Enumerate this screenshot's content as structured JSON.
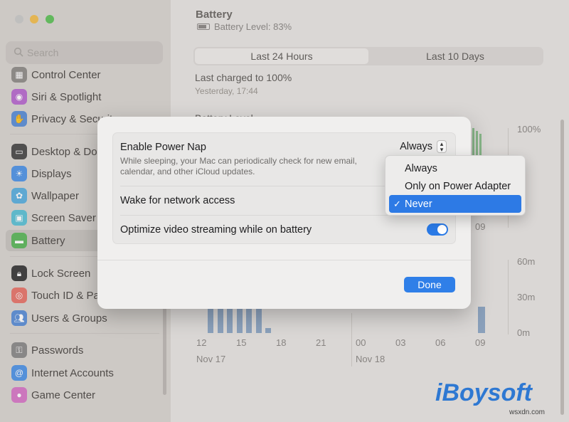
{
  "sidebar": {
    "search_placeholder": "Search",
    "items": [
      {
        "label": "Control Center",
        "icon": "control-center-icon",
        "color": "#8f8c89"
      },
      {
        "label": "Siri & Spotlight",
        "icon": "siri-icon",
        "color": "#b86ad0"
      },
      {
        "label": "Privacy & Security",
        "icon": "hand-icon",
        "color": "#5a8fd8"
      },
      {
        "label": "Desktop & Dock",
        "icon": "desktop-icon",
        "color": "#4a4a4a"
      },
      {
        "label": "Displays",
        "icon": "sun-icon",
        "color": "#4f94e8"
      },
      {
        "label": "Wallpaper",
        "icon": "flower-icon",
        "color": "#5bb0e0"
      },
      {
        "label": "Screen Saver",
        "icon": "screen-saver-icon",
        "color": "#5cc2d6"
      },
      {
        "label": "Battery",
        "icon": "battery-icon",
        "color": "#5cb85c"
      },
      {
        "label": "Lock Screen",
        "icon": "lock-icon",
        "color": "#3a3a3a"
      },
      {
        "label": "Touch ID & Password",
        "icon": "fingerprint-icon",
        "color": "#e8756a"
      },
      {
        "label": "Users & Groups",
        "icon": "users-icon",
        "color": "#5a8fd8"
      },
      {
        "label": "Passwords",
        "icon": "key-icon",
        "color": "#8a8a8a"
      },
      {
        "label": "Internet Accounts",
        "icon": "at-icon",
        "color": "#4f94e8"
      },
      {
        "label": "Game Center",
        "icon": "game-center-icon",
        "color": "#d878c8"
      }
    ]
  },
  "main": {
    "title": "Battery",
    "battery_level": "Battery Level: 83%",
    "tabs": [
      "Last 24 Hours",
      "Last 10 Days"
    ],
    "last_charged": "Last charged to 100%",
    "last_charged_time": "Yesterday, 17:44",
    "chart_label_partial": "Battery Level"
  },
  "chart_data": {
    "type": "bar",
    "title": "Battery Level",
    "yticks_level": [
      "100%"
    ],
    "yticks_usage": [
      "60m",
      "30m",
      "0m"
    ],
    "xticks": [
      "12",
      "15",
      "18",
      "21",
      "00",
      "03",
      "06",
      "09"
    ],
    "xtick_09_upper": "09",
    "date_labels": [
      "Nov 17",
      "Nov 18"
    ],
    "usage_values_min": [
      22,
      22,
      22,
      22,
      22,
      22,
      4,
      0,
      0,
      0,
      0,
      0,
      0,
      22
    ]
  },
  "dialog": {
    "rows": [
      {
        "title": "Enable Power Nap",
        "description": "While sleeping, your Mac can periodically check for new email, calendar, and other iCloud updates.",
        "value": "Always"
      },
      {
        "title": "Wake for network access"
      },
      {
        "title": "Optimize video streaming while on battery",
        "toggle": true
      }
    ],
    "done_label": "Done"
  },
  "menu": {
    "options": [
      "Always",
      "Only on Power Adapter",
      "Never"
    ],
    "selected": "Never"
  },
  "watermark": {
    "brand": "iBoysoft",
    "site": "wsxdn.com"
  }
}
